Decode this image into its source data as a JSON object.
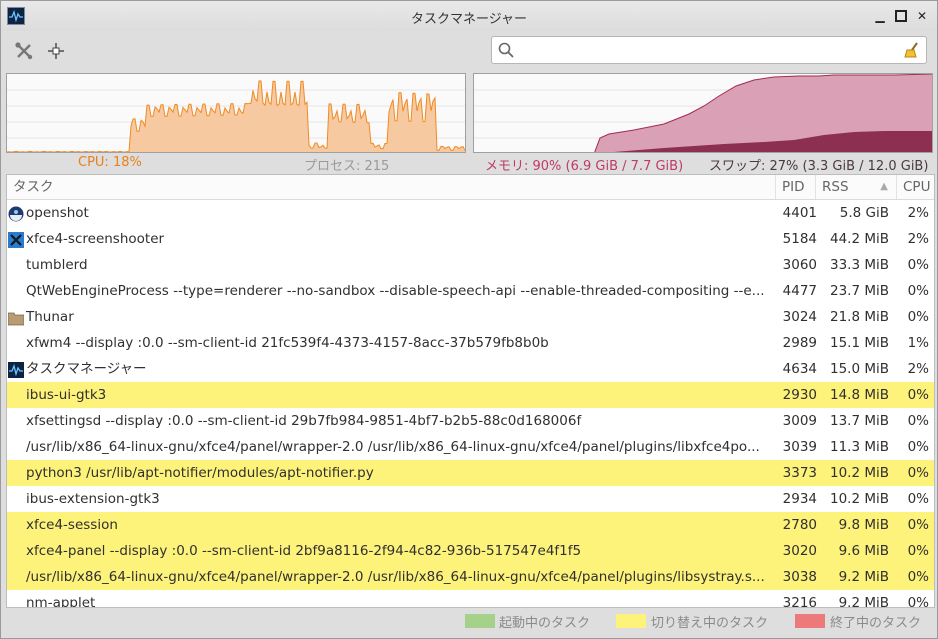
{
  "window": {
    "title": "タスクマネージャー"
  },
  "search": {
    "placeholder": "",
    "value": ""
  },
  "stats": {
    "cpu": "CPU: 18%",
    "processes": "プロセス: 215",
    "memory": "メモリ: 90% (6.9 GiB / 7.7 GiB)",
    "swap": "スワップ: 27% (3.3 GiB / 12.0 GiB)"
  },
  "colors": {
    "cpu_line": "#f08a24",
    "cpu_fill": "#f7c9a0",
    "mem_fill": "#d9a0b6",
    "mem_line": "#a32a55",
    "swap_fill": "#8c2f50",
    "highlight": "#fdf27a",
    "starting": "#a6d18a",
    "changing": "#fdf27a",
    "terminating": "#ec7a7a"
  },
  "columns": {
    "task": "タスク",
    "pid": "PID",
    "rss": "RSS",
    "cpu": "CPU",
    "sort_indicator": "▲"
  },
  "rows": [
    {
      "icon": "openshot-icon",
      "name": "openshot",
      "pid": "4401",
      "rss": "5.8 GiB",
      "cpu": "2%",
      "hl": false
    },
    {
      "icon": "screenshooter-icon",
      "name": "xfce4-screenshooter",
      "pid": "5184",
      "rss": "44.2 MiB",
      "cpu": "2%",
      "hl": false
    },
    {
      "icon": "",
      "name": "tumblerd",
      "pid": "3060",
      "rss": "33.3 MiB",
      "cpu": "0%",
      "hl": false
    },
    {
      "icon": "",
      "name": "QtWebEngineProcess --type=renderer --no-sandbox --disable-speech-api --enable-threaded-compositing --e...",
      "pid": "4477",
      "rss": "23.7 MiB",
      "cpu": "0%",
      "hl": false
    },
    {
      "icon": "folder-icon",
      "name": "Thunar",
      "pid": "3024",
      "rss": "21.8 MiB",
      "cpu": "0%",
      "hl": false
    },
    {
      "icon": "",
      "name": "xfwm4 --display :0.0 --sm-client-id 21fc539f4-4373-4157-8acc-37b579fb8b0b",
      "pid": "2989",
      "rss": "15.1 MiB",
      "cpu": "1%",
      "hl": false
    },
    {
      "icon": "task-manager-icon",
      "name": "タスクマネージャー",
      "pid": "4634",
      "rss": "15.0 MiB",
      "cpu": "2%",
      "hl": false
    },
    {
      "icon": "",
      "name": "ibus-ui-gtk3",
      "pid": "2930",
      "rss": "14.8 MiB",
      "cpu": "0%",
      "hl": true
    },
    {
      "icon": "",
      "name": "xfsettingsd --display :0.0 --sm-client-id 29b7fb984-9851-4bf7-b2b5-88c0d168006f",
      "pid": "3009",
      "rss": "13.7 MiB",
      "cpu": "0%",
      "hl": false
    },
    {
      "icon": "",
      "name": "/usr/lib/x86_64-linux-gnu/xfce4/panel/wrapper-2.0 /usr/lib/x86_64-linux-gnu/xfce4/panel/plugins/libxfce4po...",
      "pid": "3039",
      "rss": "11.3 MiB",
      "cpu": "0%",
      "hl": false
    },
    {
      "icon": "",
      "name": "python3 /usr/lib/apt-notifier/modules/apt-notifier.py",
      "pid": "3373",
      "rss": "10.2 MiB",
      "cpu": "0%",
      "hl": true
    },
    {
      "icon": "",
      "name": "ibus-extension-gtk3",
      "pid": "2934",
      "rss": "10.2 MiB",
      "cpu": "0%",
      "hl": false
    },
    {
      "icon": "",
      "name": "xfce4-session",
      "pid": "2780",
      "rss": "9.8 MiB",
      "cpu": "0%",
      "hl": true
    },
    {
      "icon": "",
      "name": "xfce4-panel --display :0.0 --sm-client-id 2bf9a8116-2f94-4c82-936b-517547e4f1f5",
      "pid": "3020",
      "rss": "9.6 MiB",
      "cpu": "0%",
      "hl": true
    },
    {
      "icon": "",
      "name": "/usr/lib/x86_64-linux-gnu/xfce4/panel/wrapper-2.0 /usr/lib/x86_64-linux-gnu/xfce4/panel/plugins/libsystray.s...",
      "pid": "3038",
      "rss": "9.2 MiB",
      "cpu": "0%",
      "hl": true
    },
    {
      "icon": "",
      "name": "nm-applet",
      "pid": "3216",
      "rss": "9.2 MiB",
      "cpu": "0%",
      "hl": false
    }
  ],
  "legend": {
    "starting": "起動中のタスク",
    "changing": "切り替え中のタスク",
    "terminating": "終了中のタスク"
  }
}
